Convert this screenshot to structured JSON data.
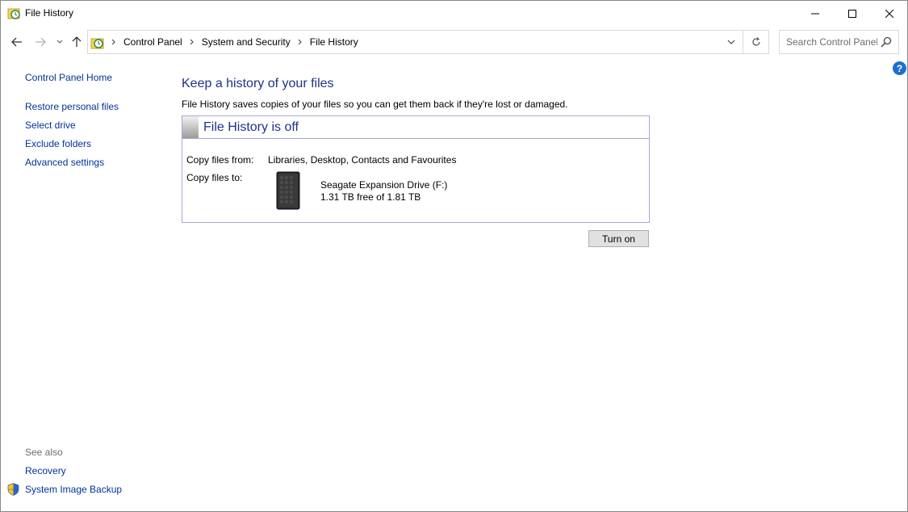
{
  "window": {
    "title": "File History",
    "app_icon": "file-history-icon",
    "controls": [
      "minimize-icon",
      "maximize-icon",
      "close-icon"
    ]
  },
  "navigation": {
    "back_icon": "arrow-left-icon",
    "forward_icon": "arrow-right-icon",
    "recent_icon": "chevron-down-icon",
    "up_icon": "arrow-up-icon",
    "breadcrumbs": [
      "Control Panel",
      "System and Security",
      "File History"
    ],
    "refresh_icon": "refresh-icon"
  },
  "search": {
    "placeholder": "Search Control Panel",
    "icon": "search-icon"
  },
  "help_label": "?",
  "sidebar": {
    "home": "Control Panel Home",
    "links": [
      "Restore personal files",
      "Select drive",
      "Exclude folders",
      "Advanced settings"
    ],
    "see_also_label": "See also",
    "see_also_links": [
      "Recovery",
      "System Image Backup"
    ]
  },
  "main": {
    "title": "Keep a history of your files",
    "description": "File History saves copies of your files so you can get them back if they're lost or damaged.",
    "status_title": "File History is off",
    "copy_from_label": "Copy files from:",
    "copy_from_value": "Libraries, Desktop, Contacts and Favourites",
    "copy_to_label": "Copy files to:",
    "drive_name": "Seagate Expansion Drive (F:)",
    "drive_space": "1.31 TB free of 1.81 TB",
    "turn_on_button": "Turn on"
  },
  "colors": {
    "link": "#003399",
    "heading": "#1e3287",
    "box_border": "#a8a8d8",
    "help_blue": "#1e6fd1"
  }
}
